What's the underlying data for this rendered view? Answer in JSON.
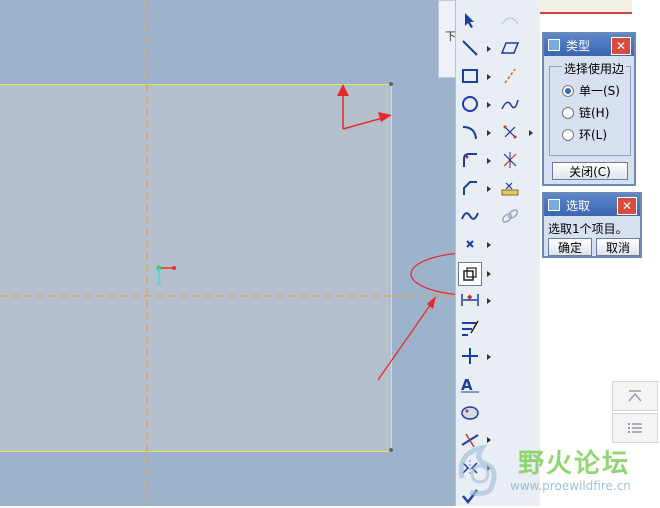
{
  "partial_label": "下",
  "dialog_type": {
    "title": "类型",
    "group_label": "选择使用边",
    "options": [
      {
        "label": "单一(S)",
        "selected": true
      },
      {
        "label": "链(H)",
        "selected": false
      },
      {
        "label": "环(L)",
        "selected": false
      }
    ],
    "close_button": "关闭(C)"
  },
  "dialog_select": {
    "title": "选取",
    "message": "选取1个项目。",
    "ok_button": "确定",
    "cancel_button": "取消"
  },
  "toolbar": {
    "active_tool": "use-edge"
  },
  "watermark": {
    "text": "野火论坛",
    "url": "www.proewildfire.cn"
  },
  "colors": {
    "canvas": "#9db3cc",
    "sketch_fill": "#b4c1cc",
    "annotation": "#e8262a",
    "centerline": "#e8a030"
  }
}
